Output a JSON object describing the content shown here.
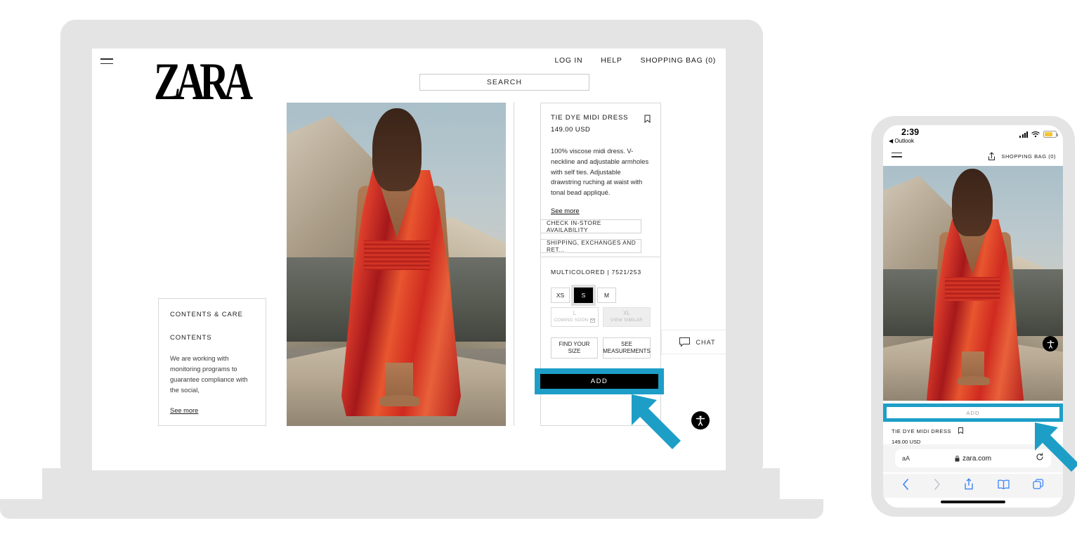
{
  "laptop": {
    "site": {
      "header": {
        "menu_icon": "hamburger-menu-icon",
        "logo": "ZARA",
        "links": [
          "LOG IN",
          "HELP",
          "SHOPPING BAG (0)"
        ],
        "search_label": "SEARCH"
      },
      "care_card": {
        "title": "CONTENTS & CARE",
        "subtitle": "CONTENTS",
        "body": "We are working with monitoring programs to guarantee compliance with the social,",
        "see_more": "See more"
      },
      "product": {
        "name": "TIE DYE MIDI DRESS",
        "price": "149.00 USD",
        "bookmark_icon": "bookmark-icon",
        "description": "100% viscose midi dress. V-neckline and adjustable armholes with self ties. Adjustable drawstring ruching at waist with tonal bead appliqué.",
        "see_more": "See more",
        "buttons": [
          "CHECK IN-STORE AVAILABILITY",
          "SHIPPING, EXCHANGES AND RET..."
        ],
        "color_line": "MULTICOLORED | 7521/253",
        "sizes": [
          {
            "label": "XS",
            "state": "available"
          },
          {
            "label": "S",
            "state": "selected"
          },
          {
            "label": "M",
            "state": "available"
          }
        ],
        "sizes_wide": [
          {
            "label": "L",
            "note": "COMING SOON",
            "icon": "envelope-icon",
            "state": "coming-soon"
          },
          {
            "label": "XL",
            "note": "VIEW SIMILAR",
            "icon": "",
            "state": "unavailable"
          }
        ],
        "helpers": [
          {
            "line1": "FIND YOUR",
            "line2": "SIZE"
          },
          {
            "line1": "SEE",
            "line2": "MEASUREMENTS"
          }
        ],
        "add_label": "ADD"
      },
      "chat": {
        "label": "CHAT",
        "icon": "chat-bubble-icon"
      },
      "accessibility_icon": "accessibility-icon"
    }
  },
  "phone": {
    "status": {
      "time": "2:39",
      "back_app": "Outlook",
      "signal_icon": "cellular-signal-icon",
      "wifi_icon": "wifi-icon",
      "battery_icon": "battery-low-power-icon"
    },
    "navbar": {
      "menu_icon": "hamburger-menu-icon",
      "share_icon": "share-icon",
      "bag_label": "SHOPPING BAG (0)"
    },
    "add_label": "ADD",
    "product": {
      "name": "TIE DYE MIDI DRESS",
      "price": "149.00 USD",
      "bookmark_icon": "bookmark-icon"
    },
    "accessibility_icon": "accessibility-icon",
    "browser": {
      "aa_label": "aA",
      "lock_icon": "lock-icon",
      "url": "zara.com",
      "reload_icon": "reload-icon",
      "tools": [
        "back-icon",
        "forward-icon",
        "share-icon",
        "bookmarks-icon",
        "tabs-icon"
      ]
    }
  },
  "annotations": {
    "highlight_color": "#1d9ec7",
    "arrow_icon": "callout-arrow-icon",
    "targets": [
      "laptop-add-button",
      "phone-add-button"
    ]
  }
}
